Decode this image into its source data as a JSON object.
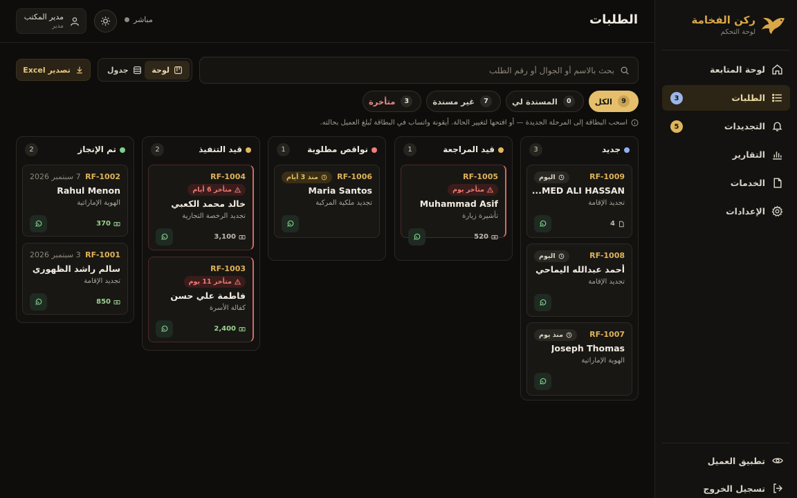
{
  "brand": {
    "name": "ركن الفخامة",
    "subtitle": "لوحة التحكم"
  },
  "sidebar": {
    "items": [
      {
        "label": "لوحة المتابعة",
        "icon": "home-icon"
      },
      {
        "label": "الطلبات",
        "icon": "list-icon",
        "badge": "3",
        "active": true
      },
      {
        "label": "التجديدات",
        "icon": "bell-icon",
        "badge": "5"
      },
      {
        "label": "التقارير",
        "icon": "chart-icon"
      },
      {
        "label": "الخدمات",
        "icon": "file-icon"
      },
      {
        "label": "الإعدادات",
        "icon": "gear-icon"
      }
    ],
    "bottom": [
      {
        "label": "تطبيق العميل",
        "icon": "eye-icon"
      },
      {
        "label": "تسجيل الخروج",
        "icon": "logout-icon"
      }
    ]
  },
  "header": {
    "title": "الطلبات",
    "live_label": "مباشر",
    "user_name": "مدير المكتب",
    "user_role": "مدير"
  },
  "toolbar": {
    "search_placeholder": "بحث بالاسم أو الجوال أو رقم الطلب",
    "view_board": "لوحة",
    "view_table": "جدول",
    "export_label": "تصدير Excel"
  },
  "filters": [
    {
      "label": "الكل",
      "count": "9",
      "active": true
    },
    {
      "label": "المسندة لي",
      "count": "0"
    },
    {
      "label": "غير مسندة",
      "count": "7"
    },
    {
      "label": "متأخرة",
      "count": "3",
      "late": true
    }
  ],
  "hint": "اسحب البطاقة إلى المرحلة الجديدة — أو افتحها لتغيير الحالة. أيقونة واتساب في البطاقة تُبلغ العميل بحالته.",
  "columns": [
    {
      "title": "جديد",
      "count": "3",
      "color": "#8fb0f0",
      "cards": [
        {
          "ref": "RF-1009",
          "tag": "اليوم",
          "tag_type": "today",
          "name": "MED ALI HASSAN...",
          "service": "تجديد الإقامة",
          "amount": "4",
          "amount_type": "doc"
        },
        {
          "ref": "RF-1008",
          "tag": "اليوم",
          "tag_type": "today",
          "name": "أحمد عبدالله اليماحي",
          "service": "تجديد الإقامة"
        },
        {
          "ref": "RF-1007",
          "tag": "منذ يوم",
          "tag_type": "today",
          "name": "Joseph Thomas",
          "service": "الهوية الإماراتية"
        }
      ]
    },
    {
      "title": "قيد المراجعة",
      "count": "1",
      "color": "#e0b85c",
      "cards": [
        {
          "ref": "RF-1005",
          "tag": "متأخر يوم",
          "tag_type": "late",
          "name": "Muhammad Asif",
          "service": "تأشيرة زيارة",
          "amount": "520",
          "amount_type": "plain",
          "overdue": true
        }
      ]
    },
    {
      "title": "نواقص مطلوبة",
      "count": "1",
      "color": "#ef7f7f",
      "cards": [
        {
          "ref": "RF-1006",
          "tag": "منذ 3 أيام",
          "tag_type": "since",
          "name": "Maria Santos",
          "service": "تجديد ملكية المركبة"
        }
      ]
    },
    {
      "title": "قيد التنفيذ",
      "count": "2",
      "color": "#e0b85c",
      "cards": [
        {
          "ref": "RF-1004",
          "tag": "متأخر 6 أيام",
          "tag_type": "late",
          "name": "خالد محمد الكعبي",
          "service": "تجديد الرخصة التجارية",
          "amount": "3,100",
          "amount_type": "plain",
          "overdue": true
        },
        {
          "ref": "RF-1003",
          "tag": "متأخر 11 يوم",
          "tag_type": "late",
          "name": "فاطمة علي حسن",
          "service": "كفالة الأسرة",
          "amount": "2,400",
          "amount_type": "green",
          "overdue": true
        }
      ]
    },
    {
      "title": "تم الإنجاز",
      "count": "2",
      "color": "#7fd08a",
      "cards": [
        {
          "ref": "RF-1002",
          "date": "7 سبتمبر 2026",
          "name": "Rahul Menon",
          "service": "الهوية الإماراتية",
          "amount": "370",
          "amount_type": "green"
        },
        {
          "ref": "RF-1001",
          "date": "3 سبتمبر 2026",
          "name": "سالم راشد الظهوري",
          "service": "تجديد الإقامة",
          "amount": "850",
          "amount_type": "green"
        }
      ]
    }
  ]
}
